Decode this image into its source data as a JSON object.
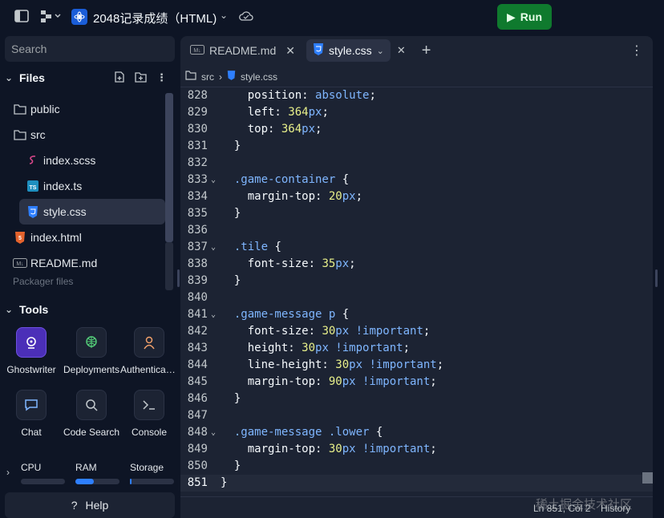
{
  "header": {
    "repl_title": "2048记录成绩（HTML)",
    "run_label": "Run",
    "colors": {
      "run": "#0f7a2e",
      "accent": "#1a5dd8"
    }
  },
  "sidebar": {
    "search_placeholder": "Search",
    "files_title": "Files",
    "tree": [
      {
        "label": "public",
        "icon": "folder-icon"
      },
      {
        "label": "src",
        "icon": "folder-open-icon"
      },
      {
        "label": "index.scss",
        "icon": "sass-icon"
      },
      {
        "label": "index.ts",
        "icon": "typescript-icon"
      },
      {
        "label": "style.css",
        "icon": "css-icon",
        "active": true
      },
      {
        "label": "index.html",
        "icon": "html5-icon"
      },
      {
        "label": "README.md",
        "icon": "markdown-icon"
      }
    ],
    "tree_partial": "Packager files",
    "tools_title": "Tools",
    "tools": [
      {
        "label": "Ghostwriter",
        "icon": "ghostwriter-icon"
      },
      {
        "label": "Deployments",
        "icon": "deployments-icon"
      },
      {
        "label": "Authentication",
        "icon": "user-icon"
      },
      {
        "label": "Chat",
        "icon": "chat-icon"
      },
      {
        "label": "Code Search",
        "icon": "search-icon"
      },
      {
        "label": "Console",
        "icon": "console-icon"
      }
    ],
    "resources": [
      {
        "label": "CPU",
        "fill": 0.0
      },
      {
        "label": "RAM",
        "fill": 0.42
      },
      {
        "label": "Storage",
        "fill": 0.03
      }
    ],
    "help_label": "Help"
  },
  "editor": {
    "tabs": [
      {
        "label": "README.md",
        "icon": "markdown-icon"
      },
      {
        "label": "style.css",
        "icon": "css-icon",
        "active": true
      }
    ],
    "breadcrumb": [
      "src",
      "style.css"
    ],
    "lines": [
      {
        "n": "828",
        "fold": "",
        "tokens": [
          [
            "p",
            "    position: "
          ],
          [
            "v",
            "absolute"
          ],
          [
            "p",
            ";"
          ]
        ]
      },
      {
        "n": "829",
        "fold": "",
        "tokens": [
          [
            "p",
            "    left: "
          ],
          [
            "n",
            "364"
          ],
          [
            "v",
            "px"
          ],
          [
            "p",
            ";"
          ]
        ]
      },
      {
        "n": "830",
        "fold": "",
        "tokens": [
          [
            "p",
            "    top: "
          ],
          [
            "n",
            "364"
          ],
          [
            "v",
            "px"
          ],
          [
            "p",
            ";"
          ]
        ]
      },
      {
        "n": "831",
        "fold": "",
        "tokens": [
          [
            "p",
            "  }"
          ]
        ]
      },
      {
        "n": "832",
        "fold": "",
        "tokens": []
      },
      {
        "n": "833",
        "fold": "v",
        "tokens": [
          [
            "s",
            "  .game-container"
          ],
          [
            "p",
            " {"
          ]
        ]
      },
      {
        "n": "834",
        "fold": "",
        "tokens": [
          [
            "p",
            "    margin-top: "
          ],
          [
            "n",
            "20"
          ],
          [
            "v",
            "px"
          ],
          [
            "p",
            ";"
          ]
        ]
      },
      {
        "n": "835",
        "fold": "",
        "tokens": [
          [
            "p",
            "  }"
          ]
        ]
      },
      {
        "n": "836",
        "fold": "",
        "tokens": []
      },
      {
        "n": "837",
        "fold": "v",
        "tokens": [
          [
            "s",
            "  .tile"
          ],
          [
            "p",
            " {"
          ]
        ]
      },
      {
        "n": "838",
        "fold": "",
        "tokens": [
          [
            "p",
            "    font-size: "
          ],
          [
            "n",
            "35"
          ],
          [
            "v",
            "px"
          ],
          [
            "p",
            ";"
          ]
        ]
      },
      {
        "n": "839",
        "fold": "",
        "tokens": [
          [
            "p",
            "  }"
          ]
        ]
      },
      {
        "n": "840",
        "fold": "",
        "tokens": []
      },
      {
        "n": "841",
        "fold": "v",
        "tokens": [
          [
            "s",
            "  .game-message p"
          ],
          [
            "p",
            " {"
          ]
        ]
      },
      {
        "n": "842",
        "fold": "",
        "tokens": [
          [
            "p",
            "    font-size: "
          ],
          [
            "n",
            "30"
          ],
          [
            "v",
            "px !important"
          ],
          [
            "p",
            ";"
          ]
        ]
      },
      {
        "n": "843",
        "fold": "",
        "tokens": [
          [
            "p",
            "    height: "
          ],
          [
            "n",
            "30"
          ],
          [
            "v",
            "px !important"
          ],
          [
            "p",
            ";"
          ]
        ]
      },
      {
        "n": "844",
        "fold": "",
        "tokens": [
          [
            "p",
            "    line-height: "
          ],
          [
            "n",
            "30"
          ],
          [
            "v",
            "px !important"
          ],
          [
            "p",
            ";"
          ]
        ]
      },
      {
        "n": "845",
        "fold": "",
        "tokens": [
          [
            "p",
            "    margin-top: "
          ],
          [
            "n",
            "90"
          ],
          [
            "v",
            "px !important"
          ],
          [
            "p",
            ";"
          ]
        ]
      },
      {
        "n": "846",
        "fold": "",
        "tokens": [
          [
            "p",
            "  }"
          ]
        ]
      },
      {
        "n": "847",
        "fold": "",
        "tokens": []
      },
      {
        "n": "848",
        "fold": "v",
        "tokens": [
          [
            "s",
            "  .game-message .lower"
          ],
          [
            "p",
            " {"
          ]
        ]
      },
      {
        "n": "849",
        "fold": "",
        "tokens": [
          [
            "p",
            "    margin-top: "
          ],
          [
            "n",
            "30"
          ],
          [
            "v",
            "px !important"
          ],
          [
            "p",
            ";"
          ]
        ]
      },
      {
        "n": "850",
        "fold": "",
        "tokens": [
          [
            "p",
            "  }"
          ]
        ]
      },
      {
        "n": "851",
        "fold": "",
        "tokens": [
          [
            "p",
            "}"
          ]
        ],
        "current": true
      }
    ],
    "status": {
      "position": "Ln 851, Col 2",
      "history": "History"
    }
  },
  "watermark": "稀土掘金技术社区"
}
